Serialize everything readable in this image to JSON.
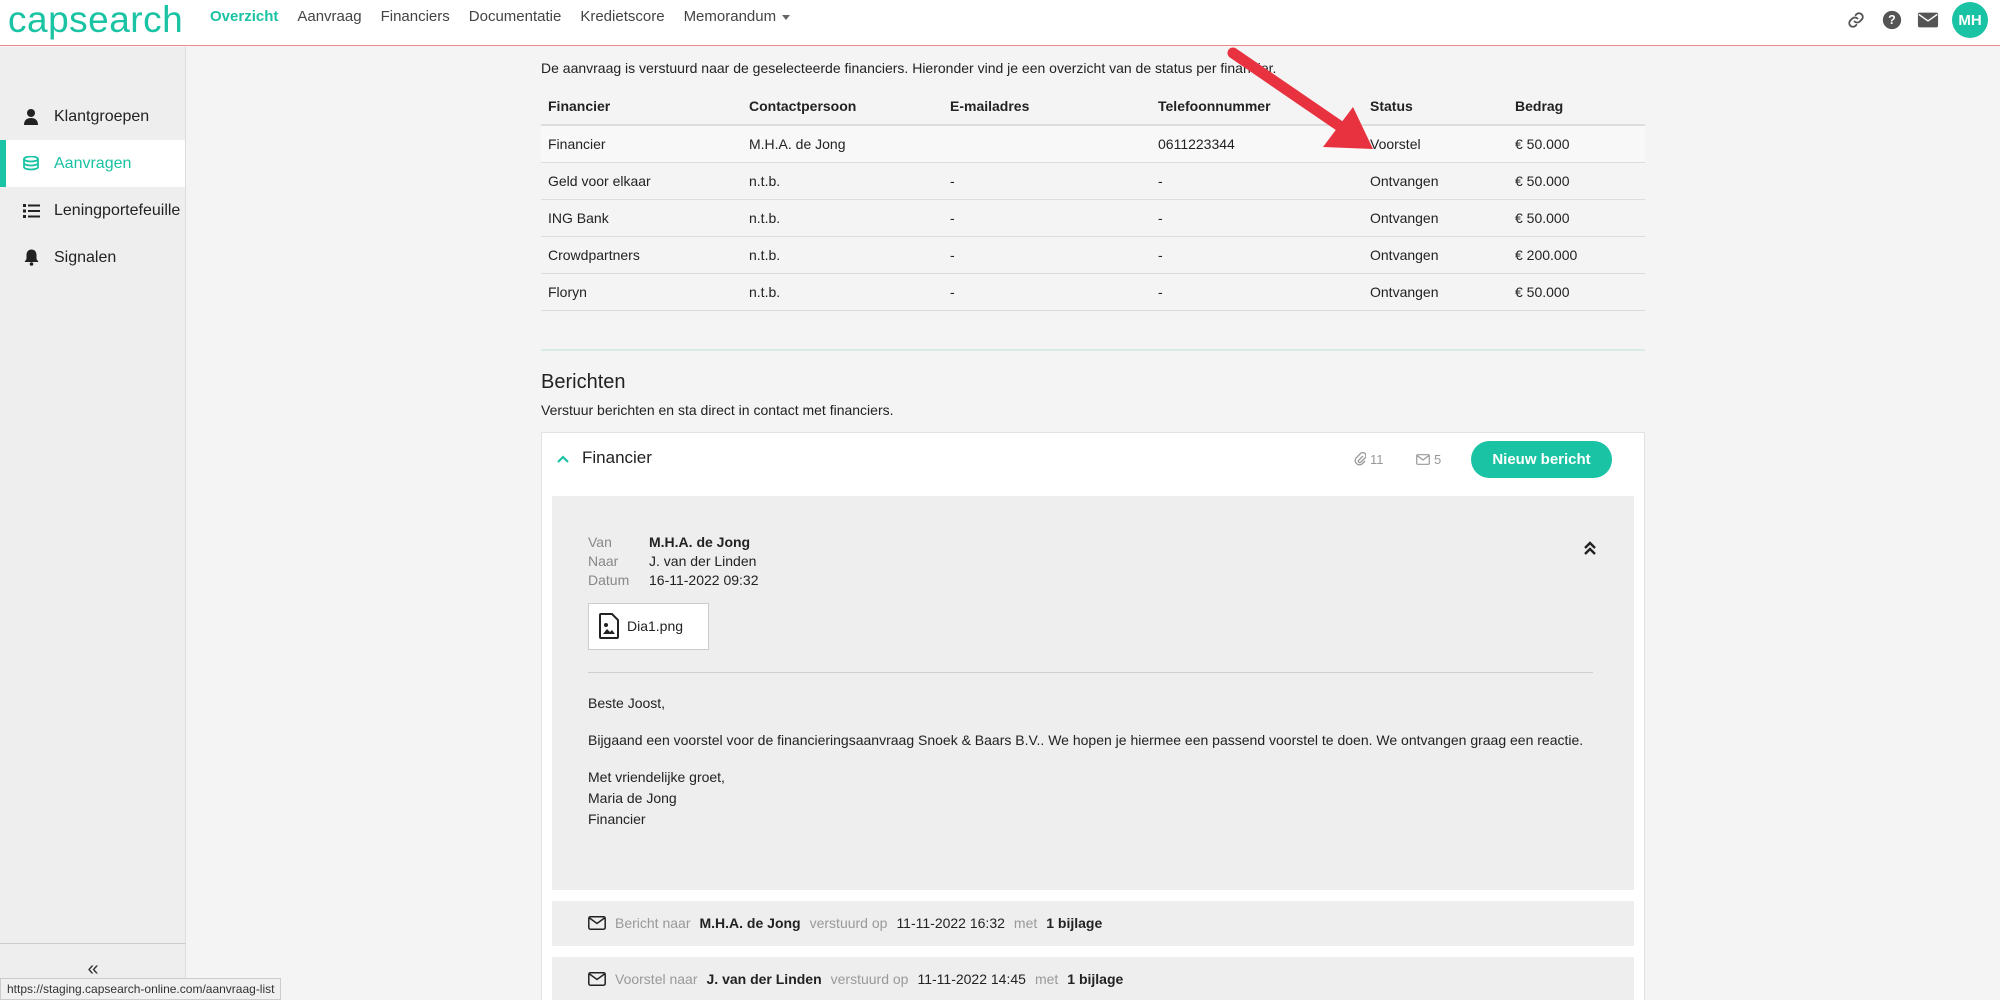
{
  "app": {
    "logo": "capsearch",
    "nav": [
      {
        "label": "Overzicht",
        "active": true
      },
      {
        "label": "Aanvraag",
        "active": false
      },
      {
        "label": "Financiers",
        "active": false
      },
      {
        "label": "Documentatie",
        "active": false
      },
      {
        "label": "Kredietscore",
        "active": false
      },
      {
        "label": "Memorandum",
        "active": false
      }
    ],
    "top_icons": [
      "link-icon",
      "help-icon",
      "mail-icon"
    ],
    "avatar": "MH",
    "accent": "#19c3a3"
  },
  "sidebar": {
    "items": [
      {
        "label": "Klantgroepen",
        "icon": "user-icon",
        "active": false
      },
      {
        "label": "Aanvragen",
        "icon": "coins-icon",
        "active": true
      },
      {
        "label": "Leningportefeuille",
        "icon": "list-icon",
        "active": false
      },
      {
        "label": "Signalen",
        "icon": "bell-icon",
        "active": false
      }
    ],
    "collapse": "«"
  },
  "statusbar": "https://staging.capsearch-online.com/aanvraag-list",
  "main": {
    "intro": "De aanvraag is verstuurd naar de geselecteerde financiers. Hieronder vind je een overzicht van de status per financier.",
    "table": {
      "headers": [
        "Financier",
        "Contactpersoon",
        "E-mailadres",
        "Telefoonnummer",
        "Status",
        "Bedrag"
      ],
      "rows": [
        [
          "Financier",
          "M.H.A. de Jong",
          "",
          "0611223344",
          "Voorstel",
          "€ 50.000"
        ],
        [
          "Geld voor elkaar",
          "n.t.b.",
          "-",
          "-",
          "Ontvangen",
          "€ 50.000"
        ],
        [
          "ING Bank",
          "n.t.b.",
          "-",
          "-",
          "Ontvangen",
          "€ 50.000"
        ],
        [
          "Crowdpartners",
          "n.t.b.",
          "-",
          "-",
          "Ontvangen",
          "€ 200.000"
        ],
        [
          "Floryn",
          "n.t.b.",
          "-",
          "-",
          "Ontvangen",
          "€ 50.000"
        ]
      ]
    },
    "berichten": {
      "title": "Berichten",
      "subtitle": "Verstuur berichten en sta direct in contact met financiers.",
      "panel": {
        "title": "Financier",
        "attachments": "11",
        "messages": "5",
        "new_button": "Nieuw bericht"
      },
      "message": {
        "van_label": "Van",
        "van": "M.H.A. de Jong",
        "naar_label": "Naar",
        "naar": "J. van der Linden",
        "datum_label": "Datum",
        "datum": "16-11-2022 09:32",
        "attachment": "Dia1.png",
        "greeting": "Beste Joost,",
        "body": "Bijgaand een voorstel voor de financieringsaanvraag Snoek & Baars B.V.. We hopen je hiermee een passend voorstel te doen. We ontvangen graag een reactie.",
        "closing1": "Met vriendelijke groet,",
        "closing2": "Maria de Jong",
        "closing3": "Financier"
      },
      "rows": [
        {
          "type": "Bericht naar",
          "to": "M.H.A. de Jong",
          "sent_label": "verstuurd op",
          "date": "11-11-2022 16:32",
          "with": "met",
          "att": "1 bijlage"
        },
        {
          "type": "Voorstel naar",
          "to": "J. van der Linden",
          "sent_label": "verstuurd op",
          "date": "11-11-2022 14:45",
          "with": "met",
          "att": "1 bijlage"
        }
      ]
    }
  }
}
